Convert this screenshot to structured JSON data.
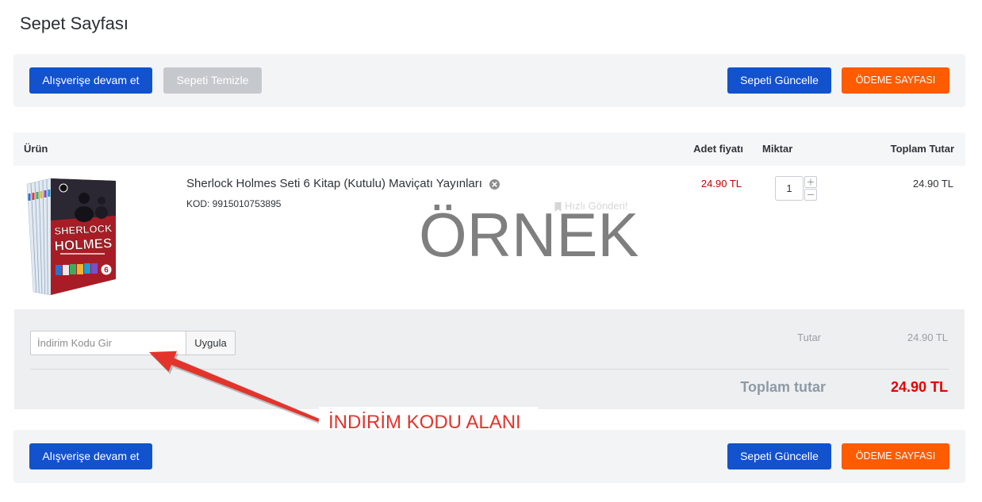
{
  "colors": {
    "primary_button": "#1252cc",
    "checkout_button": "#ff5b00",
    "disabled_button": "#c5c9cd",
    "unit_price": "#c40000",
    "grand_total": "#e60000",
    "annotation": "#e3342c"
  },
  "page": {
    "title": "Sepet Sayfası"
  },
  "toolbar_top": {
    "continue_label": "Alışverişe devam et",
    "clear_label": "Sepeti Temizle",
    "update_label": "Sepeti Güncelle",
    "checkout_label": "ÖDEME SAYFASI"
  },
  "cart": {
    "headers": {
      "product": "Ürün",
      "unit_price": "Adet fiyatı",
      "quantity": "Miktar",
      "total": "Toplam Tutar"
    },
    "items": [
      {
        "name": "Sherlock Holmes Seti 6 Kitap (Kutulu) Maviçatı Yayınları",
        "code": "KOD: 9915010753895",
        "badge": "Hızlı Gönderi!",
        "unit_price": "24.90 TL",
        "quantity": "1",
        "total": "24.90 TL",
        "cover": {
          "line1": "SHERLOCK",
          "line2": "HOLMES",
          "badge": "6"
        },
        "icons": {
          "remove": "close-circle-icon",
          "badge": "bookmark-icon",
          "increment": "plus-icon",
          "decrement": "minus-icon"
        }
      }
    ]
  },
  "watermark": "ÖRNEK",
  "summary": {
    "discount_placeholder": "İndirim Kodu Gir",
    "apply_label": "Uygula",
    "subtotal_label": "Tutar",
    "subtotal_value": "24.90 TL",
    "grand_total_label": "Toplam tutar",
    "grand_total_value": "24.90 TL"
  },
  "annotation": {
    "label": "İNDİRİM KODU ALANI"
  },
  "toolbar_bottom": {
    "continue_label": "Alışverişe devam et",
    "update_label": "Sepeti Güncelle",
    "checkout_label": "ÖDEME SAYFASI"
  }
}
